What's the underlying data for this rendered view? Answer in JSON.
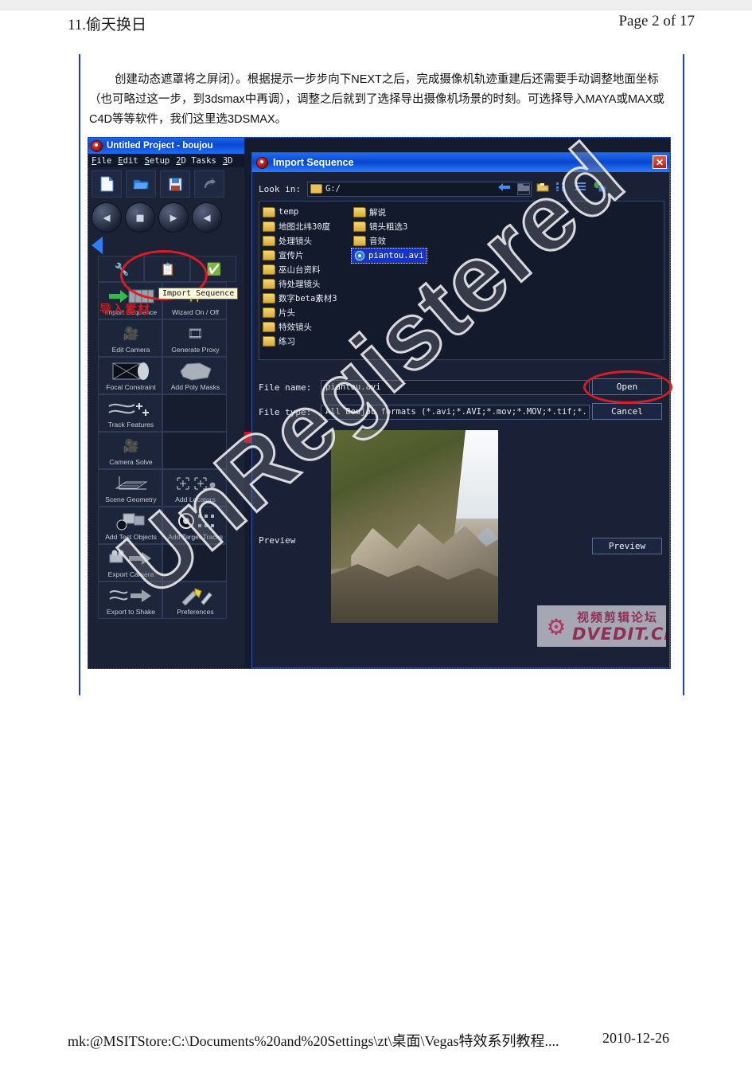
{
  "page": {
    "header_left": "11.偷天换日",
    "header_right": "Page 2 of 17",
    "footer_path": "mk:@MSITStore:C:\\Documents%20and%20Settings\\zt\\桌面\\Vegas特效系列教程....",
    "footer_date": "2010-12-26",
    "watermark": "UnRegistered"
  },
  "body": {
    "para1": "创建动态遮罩将之屏闭）。根据提示一步步向下NEXT之后，完成摄像机轨迹重建后还需要手动调整地面坐标",
    "para2": "（也可略过这一步，到3dsmax中再调），调整之后就到了选择导出摄像机场景的时刻。可选择导入MAYA或MAX或",
    "para3": "C4D等等软件，我们这里选3DSMAX。"
  },
  "boujou": {
    "title": "Untitled Project - boujou",
    "window_icon": "boujou-app-icon",
    "menu": [
      {
        "label": "File",
        "mnemonic": "F"
      },
      {
        "label": "Edit",
        "mnemonic": "E"
      },
      {
        "label": "Setup",
        "mnemonic": "S"
      },
      {
        "label": "2D Tasks",
        "mnemonic": "2"
      },
      {
        "label": "3D",
        "mnemonic": "3"
      }
    ],
    "toolbar_icons": [
      "new-document-icon",
      "open-folder-icon",
      "save-disk-icon",
      "undo-arrow-icon"
    ],
    "nav_buttons": [
      "previous-frame-icon",
      "stop-icon",
      "play-icon",
      "step-back-icon"
    ],
    "tools": [
      {
        "label": "Import Sequence",
        "icon": "import-sequence-icon"
      },
      {
        "label": "Wizard On / Off",
        "icon": "wizard-wand-icon"
      },
      {
        "label": "Edit Camera",
        "icon": "edit-camera-icon"
      },
      {
        "label": "Generate Proxy",
        "icon": "generate-proxy-icon"
      },
      {
        "label": "Focal Constraint",
        "icon": "focal-constraint-icon"
      },
      {
        "label": "Add Poly Masks",
        "icon": "add-poly-masks-icon"
      },
      {
        "label": "Track Features",
        "icon": "track-features-icon"
      },
      {
        "label": "Camera Solve",
        "icon": "camera-solve-icon"
      },
      {
        "label": "Scene Geometry",
        "icon": "scene-geometry-icon"
      },
      {
        "label": "Add Locators",
        "icon": "add-locators-icon"
      },
      {
        "label": "Add Test Objects",
        "icon": "add-test-objects-icon"
      },
      {
        "label": "Add Target Tracks",
        "icon": "add-target-tracks-icon"
      },
      {
        "label": "Export Camera",
        "icon": "export-camera-icon"
      },
      {
        "label": "Export to Shake",
        "icon": "export-to-shake-icon"
      },
      {
        "label": "Preferences",
        "icon": "preferences-icon"
      }
    ],
    "tooltip": "Import Sequence",
    "annotation_cn": "导入素材"
  },
  "dialog": {
    "title": "Import Sequence",
    "close_label": "✕",
    "lookin_label": "Look in:",
    "lookin_value": "G:/",
    "toolbar_icons": [
      "back-arrow-icon",
      "parent-folder-icon",
      "new-folder-icon",
      "list-view-icon",
      "detail-view-icon",
      "network-places-icon"
    ],
    "files_col1": [
      {
        "name": "temp",
        "type": "folder"
      },
      {
        "name": "地图北纬30度",
        "type": "folder"
      },
      {
        "name": "处理镜头",
        "type": "folder"
      },
      {
        "name": "宣传片",
        "type": "folder"
      },
      {
        "name": "巫山台资料",
        "type": "folder"
      },
      {
        "name": "待处理镜头",
        "type": "folder"
      },
      {
        "name": "数字beta素材3",
        "type": "folder"
      },
      {
        "name": "片头",
        "type": "folder"
      },
      {
        "name": "特效镜头",
        "type": "folder"
      },
      {
        "name": "练习",
        "type": "folder"
      }
    ],
    "files_col2": [
      {
        "name": "解说",
        "type": "folder"
      },
      {
        "name": "镜头粗选3",
        "type": "folder"
      },
      {
        "name": "音效",
        "type": "folder"
      },
      {
        "name": "piantou.avi",
        "type": "file",
        "selected": true
      }
    ],
    "filename_label": "File name:",
    "filename_value": "piantou.avi",
    "filetype_label": "File type:",
    "filetype_value": "All Boujou formats (*.avi;*.AVI;*.mov;*.MOV;*.tif;*.",
    "open_label": "Open",
    "cancel_label": "Cancel",
    "preview_label": "Preview",
    "preview_button_label": "Preview"
  },
  "overlay_badge": {
    "cn_text": "视频剪辑论坛",
    "en_text": "DVEDIT.CN",
    "gear_icon": "gear-icon"
  },
  "colors": {
    "accent_blue": "#1d3fd0",
    "titlebar_blue": "#0b49cf",
    "annotation_red": "#e01a22",
    "dialog_bg": "#1a2136",
    "selection_blue": "#1635c8"
  }
}
